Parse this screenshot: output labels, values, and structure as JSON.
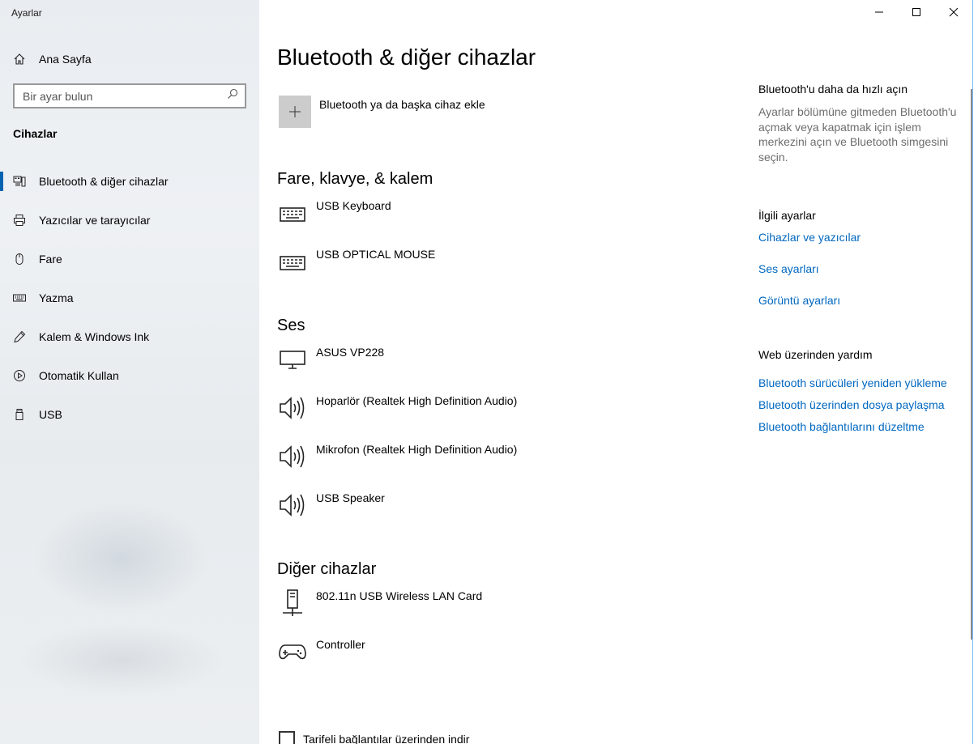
{
  "window": {
    "title": "Ayarlar"
  },
  "sidebar": {
    "home_label": "Ana Sayfa",
    "search_placeholder": "Bir ayar bulun",
    "section": "Cihazlar",
    "items": [
      {
        "label": "Bluetooth & diğer cihazlar",
        "icon": "bluetooth-devices-icon",
        "active": true
      },
      {
        "label": "Yazıcılar ve tarayıcılar",
        "icon": "printer-icon"
      },
      {
        "label": "Fare",
        "icon": "mouse-icon"
      },
      {
        "label": "Yazma",
        "icon": "keyboard-icon"
      },
      {
        "label": "Kalem & Windows Ink",
        "icon": "pen-icon"
      },
      {
        "label": "Otomatik Kullan",
        "icon": "autoplay-icon"
      },
      {
        "label": "USB",
        "icon": "usb-icon"
      }
    ]
  },
  "main": {
    "title": "Bluetooth & diğer cihazlar",
    "add_device_label": "Bluetooth ya da başka cihaz ekle",
    "groups": {
      "input": {
        "title": "Fare, klavye, & kalem",
        "devices": [
          "USB Keyboard",
          "USB OPTICAL MOUSE"
        ]
      },
      "audio": {
        "title": "Ses",
        "devices": [
          "ASUS VP228",
          "Hoparlör (Realtek High Definition Audio)",
          "Mikrofon (Realtek High Definition Audio)",
          "USB Speaker"
        ]
      },
      "other": {
        "title": "Diğer cihazlar",
        "devices": [
          "802.11n USB Wireless LAN Card",
          "Controller"
        ]
      }
    },
    "metered_label": "Tarifeli bağlantılar üzerinden indir"
  },
  "rail": {
    "quick_title": "Bluetooth'u daha da hızlı açın",
    "quick_desc": "Ayarlar bölümüne gitmeden Bluetooth'u açmak veya kapatmak için işlem merkezini açın ve Bluetooth simgesini seçin.",
    "related_title": "İlgili ayarlar",
    "related_links": [
      "Cihazlar ve yazıcılar",
      "Ses ayarları",
      "Görüntü ayarları"
    ],
    "help_title": "Web üzerinden yardım",
    "help_links": [
      "Bluetooth sürücüleri yeniden yükleme",
      "Bluetooth üzerinden dosya paylaşma",
      "Bluetooth bağlantılarını düzeltme"
    ]
  }
}
